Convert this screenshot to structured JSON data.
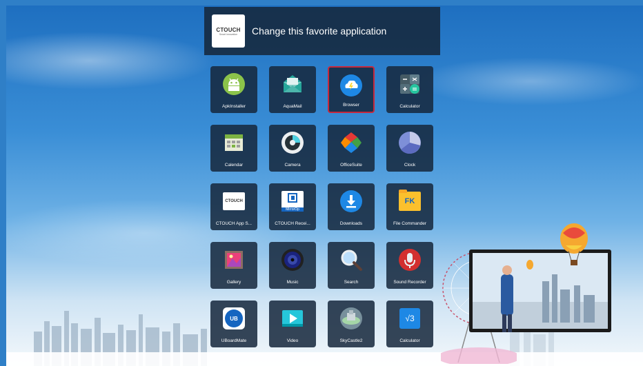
{
  "header": {
    "title": "Change this favorite application",
    "app_logo_brand": "CTOUCH",
    "app_logo_tagline": "Smart innovation"
  },
  "apps": [
    {
      "label": "ApkInstaller",
      "icon": "android-icon"
    },
    {
      "label": "AquaMail",
      "icon": "mail-envelope-icon"
    },
    {
      "label": "Browser",
      "icon": "cloud-browser-icon",
      "selected": true
    },
    {
      "label": "Calculator",
      "icon": "calculator-icon"
    },
    {
      "label": "Calendar",
      "icon": "calendar-icon"
    },
    {
      "label": "Camera",
      "icon": "camera-lens-icon"
    },
    {
      "label": "OfficeSuite",
      "icon": "officesuite-icon"
    },
    {
      "label": "Clock",
      "icon": "clock-icon"
    },
    {
      "label": "CTOUCH App S...",
      "icon": "ctouch-logo-icon"
    },
    {
      "label": "CTOUCH Recei...",
      "icon": "mirrorop-icon"
    },
    {
      "label": "Downloads",
      "icon": "download-icon"
    },
    {
      "label": "File Commander",
      "icon": "folder-icon"
    },
    {
      "label": "Gallery",
      "icon": "gallery-icon"
    },
    {
      "label": "Music",
      "icon": "speaker-icon"
    },
    {
      "label": "Search",
      "icon": "magnifier-icon"
    },
    {
      "label": "Sound Recorder",
      "icon": "microphone-icon"
    },
    {
      "label": "UBoardMate",
      "icon": "uboardmate-icon"
    },
    {
      "label": "Video",
      "icon": "play-icon"
    },
    {
      "label": "SkyCastle2",
      "icon": "skycastle-icon"
    },
    {
      "label": "Calculator",
      "icon": "math-calculator-icon"
    }
  ],
  "icon_text": {
    "ctouch": "CTOUCH",
    "mirrorop": "MirrorOp",
    "fk": "FK",
    "v3": "√3",
    "uboard": "UB"
  },
  "colors": {
    "selection_border": "#c8283c",
    "tile_bg": "#16283c"
  }
}
